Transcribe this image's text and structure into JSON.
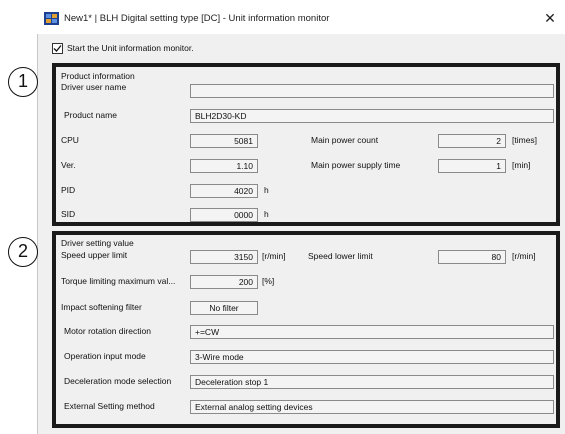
{
  "window": {
    "title": "New1* | BLH Digital setting type [DC] - Unit information monitor",
    "close_glyph": "✕"
  },
  "monitor_checkbox": {
    "label": "Start the Unit information monitor.",
    "checked": true
  },
  "callouts": [
    "1",
    "2"
  ],
  "product_info": {
    "title": "Product information",
    "driver_user_name": {
      "label": "Driver user name",
      "value": ""
    },
    "product_name": {
      "label": "Product name",
      "value": "BLH2D30-KD"
    },
    "cpu": {
      "label": "CPU",
      "value": "5081"
    },
    "ver": {
      "label": "Ver.",
      "value": "1.10"
    },
    "pid": {
      "label": "PID",
      "value": "4020",
      "unit": "h"
    },
    "sid": {
      "label": "SID",
      "value": "0000",
      "unit": "h"
    },
    "main_power_count": {
      "label": "Main power count",
      "value": "2",
      "unit": "[times]"
    },
    "main_power_supply_time": {
      "label": "Main power supply time",
      "value": "1",
      "unit": "[min]"
    }
  },
  "driver_settings": {
    "title": "Driver setting value",
    "speed_upper_limit": {
      "label": "Speed upper limit",
      "value": "3150",
      "unit": "[r/min]"
    },
    "speed_lower_limit": {
      "label": "Speed lower limit",
      "value": "80",
      "unit": "[r/min]"
    },
    "torque_limit": {
      "label": "Torque limiting maximum val...",
      "value": "200",
      "unit": "[%]"
    },
    "impact_softening_filter": {
      "label": "Impact softening filter",
      "value": "No filter"
    },
    "motor_rotation_direction": {
      "label": "Motor rotation direction",
      "value": "+=CW"
    },
    "operation_input_mode": {
      "label": "Operation input mode",
      "value": "3-Wire mode"
    },
    "deceleration_mode": {
      "label": "Deceleration mode selection",
      "value": "Deceleration stop 1"
    },
    "external_setting_method": {
      "label": "External Setting method",
      "value": "External analog setting devices"
    }
  },
  "colors": {
    "panel_border": "#1a1a1a",
    "window_bg": "#f0f0f0",
    "field_bg": "#f4f4f4",
    "field_border": "#8a8a8a"
  },
  "icons": {
    "app": "app-icon",
    "close": "close-icon",
    "check": "check-icon"
  }
}
